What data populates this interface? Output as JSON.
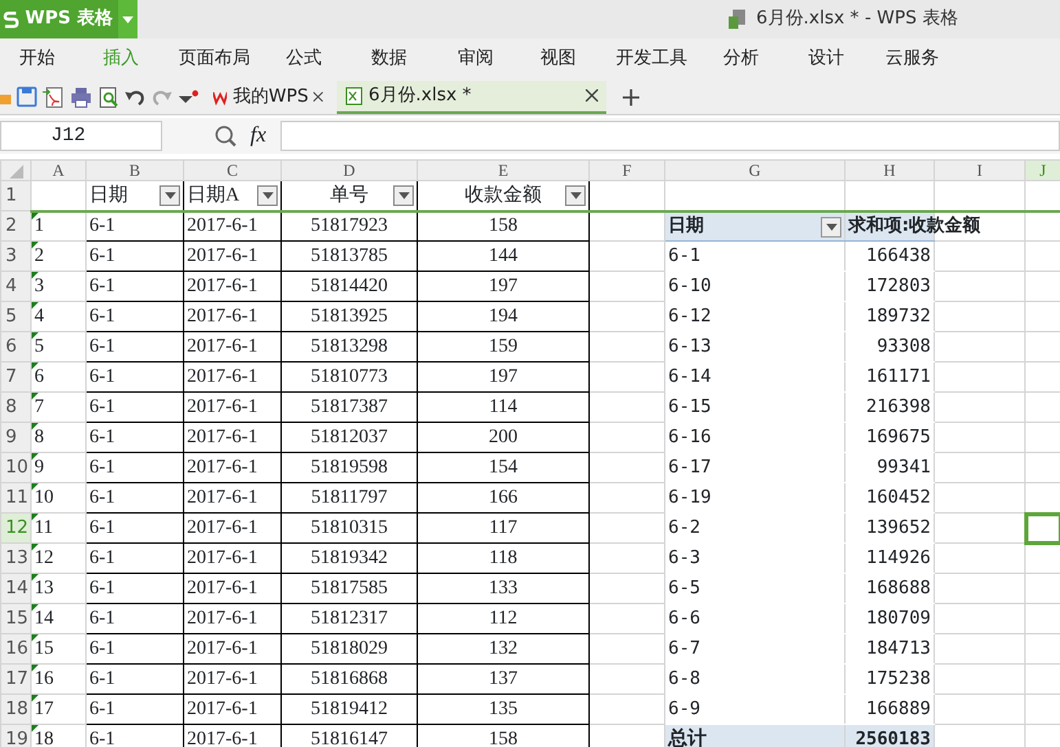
{
  "app_button": {
    "label": "WPS 表格"
  },
  "window": {
    "title": "6月份.xlsx * - WPS 表格"
  },
  "menu": [
    {
      "label": "开始",
      "selected": false
    },
    {
      "label": "插入",
      "selected": true
    },
    {
      "label": "页面布局",
      "selected": false
    },
    {
      "label": "公式",
      "selected": false
    },
    {
      "label": "数据",
      "selected": false
    },
    {
      "label": "审阅",
      "selected": false
    },
    {
      "label": "视图",
      "selected": false
    },
    {
      "label": "开发工具",
      "selected": false
    },
    {
      "label": "分析",
      "selected": false
    },
    {
      "label": "设计",
      "selected": false
    },
    {
      "label": "云服务",
      "selected": false
    }
  ],
  "doc_tabs": [
    {
      "label": "我的WPS",
      "kind": "home",
      "selected": false
    },
    {
      "label": "6月份.xlsx *",
      "kind": "sheet",
      "selected": true
    }
  ],
  "formula_bar": {
    "name_box": "J12",
    "fx": "fx"
  },
  "columns": [
    {
      "label": "A",
      "selected": false
    },
    {
      "label": "B",
      "selected": false
    },
    {
      "label": "C",
      "selected": false
    },
    {
      "label": "D",
      "selected": false
    },
    {
      "label": "E",
      "selected": false
    },
    {
      "label": "F",
      "selected": false
    },
    {
      "label": "G",
      "selected": false
    },
    {
      "label": "H",
      "selected": false
    },
    {
      "label": "I",
      "selected": false
    },
    {
      "label": "J",
      "selected": true
    }
  ],
  "rows": [
    {
      "number": "1",
      "selected": false,
      "flag": false,
      "cells": [
        "",
        "日期",
        "日期A",
        "单号",
        "收款金额"
      ]
    },
    {
      "number": "2",
      "selected": false,
      "flag": true,
      "cells": [
        "1",
        "6-1",
        "2017-6-1",
        "51817923",
        "158"
      ]
    },
    {
      "number": "3",
      "selected": false,
      "flag": true,
      "cells": [
        "2",
        "6-1",
        "2017-6-1",
        "51813785",
        "144"
      ]
    },
    {
      "number": "4",
      "selected": false,
      "flag": true,
      "cells": [
        "3",
        "6-1",
        "2017-6-1",
        "51814420",
        "197"
      ]
    },
    {
      "number": "5",
      "selected": false,
      "flag": true,
      "cells": [
        "4",
        "6-1",
        "2017-6-1",
        "51813925",
        "194"
      ]
    },
    {
      "number": "6",
      "selected": false,
      "flag": true,
      "cells": [
        "5",
        "6-1",
        "2017-6-1",
        "51813298",
        "159"
      ]
    },
    {
      "number": "7",
      "selected": false,
      "flag": true,
      "cells": [
        "6",
        "6-1",
        "2017-6-1",
        "51810773",
        "197"
      ]
    },
    {
      "number": "8",
      "selected": false,
      "flag": true,
      "cells": [
        "7",
        "6-1",
        "2017-6-1",
        "51817387",
        "114"
      ]
    },
    {
      "number": "9",
      "selected": false,
      "flag": true,
      "cells": [
        "8",
        "6-1",
        "2017-6-1",
        "51812037",
        "200"
      ]
    },
    {
      "number": "10",
      "selected": false,
      "flag": true,
      "cells": [
        "9",
        "6-1",
        "2017-6-1",
        "51819598",
        "154"
      ]
    },
    {
      "number": "11",
      "selected": false,
      "flag": true,
      "cells": [
        "10",
        "6-1",
        "2017-6-1",
        "51811797",
        "166"
      ]
    },
    {
      "number": "12",
      "selected": true,
      "flag": true,
      "cells": [
        "11",
        "6-1",
        "2017-6-1",
        "51810315",
        "117"
      ]
    },
    {
      "number": "13",
      "selected": false,
      "flag": true,
      "cells": [
        "12",
        "6-1",
        "2017-6-1",
        "51819342",
        "118"
      ]
    },
    {
      "number": "14",
      "selected": false,
      "flag": true,
      "cells": [
        "13",
        "6-1",
        "2017-6-1",
        "51817585",
        "133"
      ]
    },
    {
      "number": "15",
      "selected": false,
      "flag": true,
      "cells": [
        "14",
        "6-1",
        "2017-6-1",
        "51812317",
        "112"
      ]
    },
    {
      "number": "16",
      "selected": false,
      "flag": true,
      "cells": [
        "15",
        "6-1",
        "2017-6-1",
        "51818029",
        "132"
      ]
    },
    {
      "number": "17",
      "selected": false,
      "flag": true,
      "cells": [
        "16",
        "6-1",
        "2017-6-1",
        "51816868",
        "137"
      ]
    },
    {
      "number": "18",
      "selected": false,
      "flag": true,
      "cells": [
        "17",
        "6-1",
        "2017-6-1",
        "51819412",
        "135"
      ]
    },
    {
      "number": "19",
      "selected": false,
      "flag": true,
      "cells": [
        "18",
        "6-1",
        "2017-6-1",
        "51816147",
        "158"
      ]
    }
  ],
  "pivot": {
    "header": {
      "field": "日期",
      "value": "求和项:收款金额"
    },
    "rows": [
      {
        "label": "6-1",
        "value": "166438"
      },
      {
        "label": "6-10",
        "value": "172803"
      },
      {
        "label": "6-12",
        "value": "189732"
      },
      {
        "label": "6-13",
        "value": "93308"
      },
      {
        "label": "6-14",
        "value": "161171"
      },
      {
        "label": "6-15",
        "value": "216398"
      },
      {
        "label": "6-16",
        "value": "169675"
      },
      {
        "label": "6-17",
        "value": "99341"
      },
      {
        "label": "6-19",
        "value": "160452"
      },
      {
        "label": "6-2",
        "value": "139652"
      },
      {
        "label": "6-3",
        "value": "114926"
      },
      {
        "label": "6-5",
        "value": "168688"
      },
      {
        "label": "6-6",
        "value": "180709"
      },
      {
        "label": "6-7",
        "value": "184713"
      },
      {
        "label": "6-8",
        "value": "175238"
      },
      {
        "label": "6-9",
        "value": "166889"
      }
    ],
    "total": {
      "label": "总计",
      "value": "2560183"
    }
  }
}
